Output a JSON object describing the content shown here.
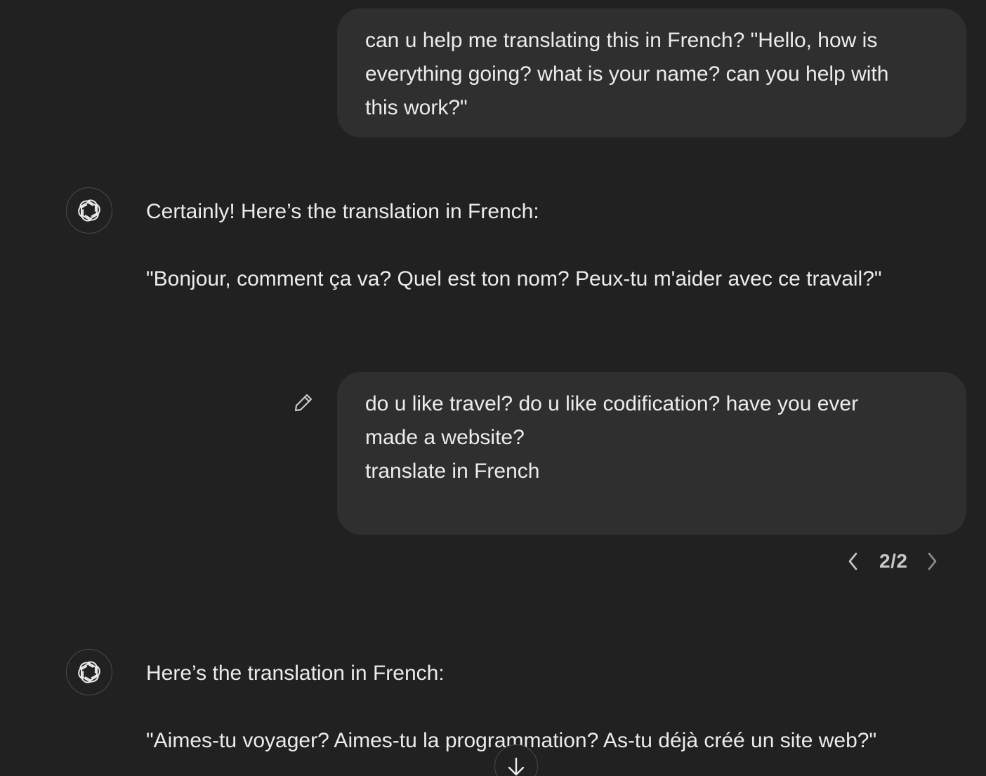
{
  "conversation": {
    "messages": [
      {
        "role": "user",
        "lines": [
          "can u help me translating this in French? \"Hello, how is",
          "everything going? what is your name? can you help with",
          "this work?\""
        ]
      },
      {
        "role": "assistant",
        "intro": "Certainly! Here’s the translation in French:",
        "translation": "\"Bonjour, comment ça va? Quel est ton nom? Peux-tu m'aider avec ce travail?\""
      },
      {
        "role": "user",
        "lines": [
          "do u like travel? do u like codification? have you ever",
          "made a website?",
          "translate in French"
        ],
        "version_pager": {
          "current": 2,
          "total": 2,
          "label": "2/2"
        }
      },
      {
        "role": "assistant",
        "intro": "Here’s the translation in French:",
        "translation": "\"Aimes-tu voyager? Aimes-tu la programmation? As-tu déjà créé un site web?\""
      }
    ]
  },
  "icons": {
    "assistant_avatar": "openai-logo-icon",
    "edit": "pencil-icon",
    "pager_prev": "chevron-left-icon",
    "pager_next": "chevron-right-icon",
    "scroll_down": "arrow-down-icon"
  },
  "colors": {
    "background": "#212121",
    "user_bubble": "#2f2f2f",
    "text": "#ececec",
    "muted_text": "#c8c8c8",
    "border": "#4a4a4a"
  }
}
